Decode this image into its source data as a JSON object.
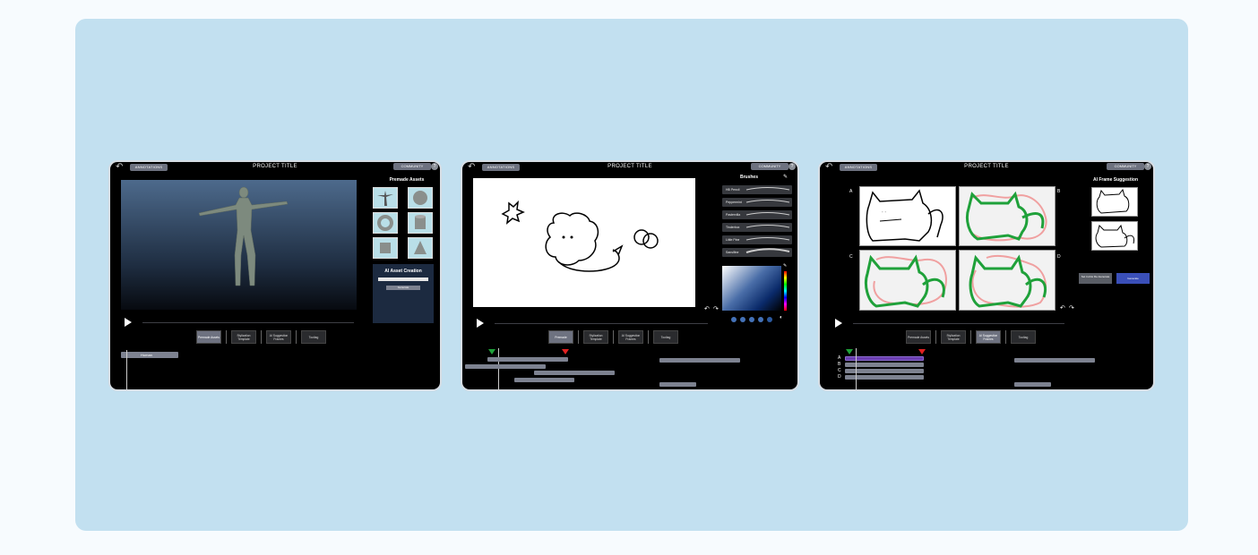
{
  "tabs": [
    {
      "back_icon": "back-arrow-icon",
      "annotations": "ANNOTATIONS",
      "title": "PROJECT TITLE",
      "community": "COMMUNITY",
      "help": "?",
      "assets_title": "Premade Assets",
      "ai_title": "AI Asset Creation",
      "generate": "Generate",
      "buttons": [
        "Premade Assets",
        "Stylization Template",
        "AI Suggestion Frames",
        "Tooltag"
      ],
      "timeline_label": "Human"
    },
    {
      "annotations": "ANNOTATIONS",
      "title": "PROJECT TITLE",
      "community": "COMMUNITY",
      "help": "?",
      "brushes_title": "Brushes",
      "brushes": [
        "HB Pencil",
        "Peppermint",
        "Pastervilla",
        "Tinderbox",
        "Little Pine",
        "Sansifine"
      ],
      "buttons": [
        "Premade",
        "Stylization Template",
        "AI Suggestion Frames",
        "Tooltag"
      ]
    },
    {
      "annotations": "ANNOTATIONS",
      "title": "PROJECT TITLE",
      "community": "COMMUNITY",
      "help": "?",
      "ai_title": "AI Frame Suggestion",
      "frame_labels": [
        "A",
        "B",
        "C",
        "D"
      ],
      "set_inbetween": "Set in-btw Re-Generate",
      "generate": "Generate",
      "buttons": [
        "Premade Assets",
        "Stylization Template",
        "AI Suggestion Frames",
        "Tooltag"
      ],
      "track_labels": [
        "A",
        "B",
        "C",
        "D"
      ]
    }
  ],
  "colors": {
    "background": "#c2e0f0",
    "marker_start": "#1fa13a",
    "marker_end": "#e02020",
    "active_button": "#6e7280",
    "generate_button": "#3a4fb8",
    "drawing_green": "#1fa13a",
    "drawing_pink": "#f0a0a0"
  }
}
